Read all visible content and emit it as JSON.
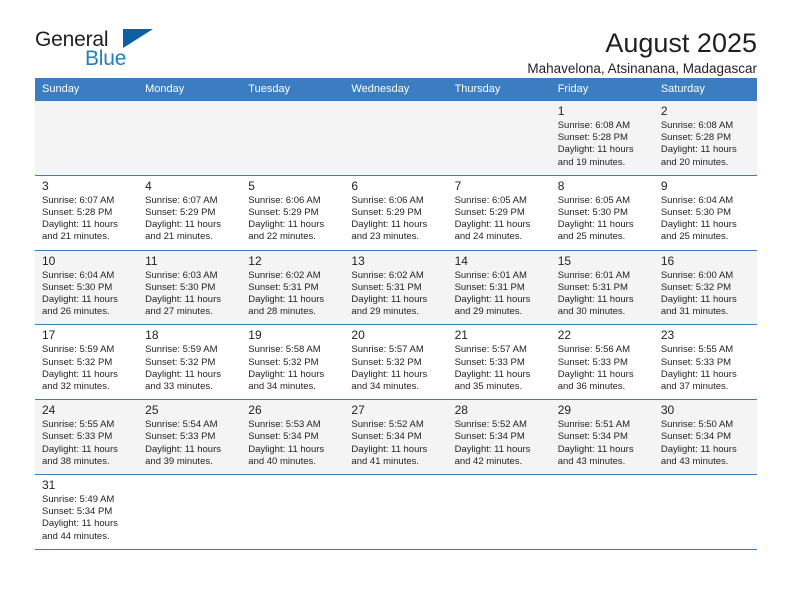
{
  "brand": {
    "name_part1": "General",
    "name_part2": "Blue",
    "accent_color": "#1f7fc4",
    "flag_color": "#0c5fa3"
  },
  "header": {
    "title": "August 2025",
    "subtitle": "Mahavelona, Atsinanana, Madagascar"
  },
  "calendar": {
    "header_bg": "#3b7dc0",
    "weekdays": [
      "Sunday",
      "Monday",
      "Tuesday",
      "Wednesday",
      "Thursday",
      "Friday",
      "Saturday"
    ],
    "weeks": [
      [
        {
          "day": "",
          "info": "",
          "empty": true
        },
        {
          "day": "",
          "info": "",
          "empty": true
        },
        {
          "day": "",
          "info": "",
          "empty": true
        },
        {
          "day": "",
          "info": "",
          "empty": true
        },
        {
          "day": "",
          "info": "",
          "empty": true
        },
        {
          "day": "1",
          "info": "Sunrise: 6:08 AM\nSunset: 5:28 PM\nDaylight: 11 hours\nand 19 minutes."
        },
        {
          "day": "2",
          "info": "Sunrise: 6:08 AM\nSunset: 5:28 PM\nDaylight: 11 hours\nand 20 minutes."
        }
      ],
      [
        {
          "day": "3",
          "info": "Sunrise: 6:07 AM\nSunset: 5:28 PM\nDaylight: 11 hours\nand 21 minutes."
        },
        {
          "day": "4",
          "info": "Sunrise: 6:07 AM\nSunset: 5:29 PM\nDaylight: 11 hours\nand 21 minutes."
        },
        {
          "day": "5",
          "info": "Sunrise: 6:06 AM\nSunset: 5:29 PM\nDaylight: 11 hours\nand 22 minutes."
        },
        {
          "day": "6",
          "info": "Sunrise: 6:06 AM\nSunset: 5:29 PM\nDaylight: 11 hours\nand 23 minutes."
        },
        {
          "day": "7",
          "info": "Sunrise: 6:05 AM\nSunset: 5:29 PM\nDaylight: 11 hours\nand 24 minutes."
        },
        {
          "day": "8",
          "info": "Sunrise: 6:05 AM\nSunset: 5:30 PM\nDaylight: 11 hours\nand 25 minutes."
        },
        {
          "day": "9",
          "info": "Sunrise: 6:04 AM\nSunset: 5:30 PM\nDaylight: 11 hours\nand 25 minutes."
        }
      ],
      [
        {
          "day": "10",
          "info": "Sunrise: 6:04 AM\nSunset: 5:30 PM\nDaylight: 11 hours\nand 26 minutes."
        },
        {
          "day": "11",
          "info": "Sunrise: 6:03 AM\nSunset: 5:30 PM\nDaylight: 11 hours\nand 27 minutes."
        },
        {
          "day": "12",
          "info": "Sunrise: 6:02 AM\nSunset: 5:31 PM\nDaylight: 11 hours\nand 28 minutes."
        },
        {
          "day": "13",
          "info": "Sunrise: 6:02 AM\nSunset: 5:31 PM\nDaylight: 11 hours\nand 29 minutes."
        },
        {
          "day": "14",
          "info": "Sunrise: 6:01 AM\nSunset: 5:31 PM\nDaylight: 11 hours\nand 29 minutes."
        },
        {
          "day": "15",
          "info": "Sunrise: 6:01 AM\nSunset: 5:31 PM\nDaylight: 11 hours\nand 30 minutes."
        },
        {
          "day": "16",
          "info": "Sunrise: 6:00 AM\nSunset: 5:32 PM\nDaylight: 11 hours\nand 31 minutes."
        }
      ],
      [
        {
          "day": "17",
          "info": "Sunrise: 5:59 AM\nSunset: 5:32 PM\nDaylight: 11 hours\nand 32 minutes."
        },
        {
          "day": "18",
          "info": "Sunrise: 5:59 AM\nSunset: 5:32 PM\nDaylight: 11 hours\nand 33 minutes."
        },
        {
          "day": "19",
          "info": "Sunrise: 5:58 AM\nSunset: 5:32 PM\nDaylight: 11 hours\nand 34 minutes."
        },
        {
          "day": "20",
          "info": "Sunrise: 5:57 AM\nSunset: 5:32 PM\nDaylight: 11 hours\nand 34 minutes."
        },
        {
          "day": "21",
          "info": "Sunrise: 5:57 AM\nSunset: 5:33 PM\nDaylight: 11 hours\nand 35 minutes."
        },
        {
          "day": "22",
          "info": "Sunrise: 5:56 AM\nSunset: 5:33 PM\nDaylight: 11 hours\nand 36 minutes."
        },
        {
          "day": "23",
          "info": "Sunrise: 5:55 AM\nSunset: 5:33 PM\nDaylight: 11 hours\nand 37 minutes."
        }
      ],
      [
        {
          "day": "24",
          "info": "Sunrise: 5:55 AM\nSunset: 5:33 PM\nDaylight: 11 hours\nand 38 minutes."
        },
        {
          "day": "25",
          "info": "Sunrise: 5:54 AM\nSunset: 5:33 PM\nDaylight: 11 hours\nand 39 minutes."
        },
        {
          "day": "26",
          "info": "Sunrise: 5:53 AM\nSunset: 5:34 PM\nDaylight: 11 hours\nand 40 minutes."
        },
        {
          "day": "27",
          "info": "Sunrise: 5:52 AM\nSunset: 5:34 PM\nDaylight: 11 hours\nand 41 minutes."
        },
        {
          "day": "28",
          "info": "Sunrise: 5:52 AM\nSunset: 5:34 PM\nDaylight: 11 hours\nand 42 minutes."
        },
        {
          "day": "29",
          "info": "Sunrise: 5:51 AM\nSunset: 5:34 PM\nDaylight: 11 hours\nand 43 minutes."
        },
        {
          "day": "30",
          "info": "Sunrise: 5:50 AM\nSunset: 5:34 PM\nDaylight: 11 hours\nand 43 minutes."
        }
      ],
      [
        {
          "day": "31",
          "info": "Sunrise: 5:49 AM\nSunset: 5:34 PM\nDaylight: 11 hours\nand 44 minutes."
        },
        {
          "day": "",
          "info": "",
          "empty": true
        },
        {
          "day": "",
          "info": "",
          "empty": true
        },
        {
          "day": "",
          "info": "",
          "empty": true
        },
        {
          "day": "",
          "info": "",
          "empty": true
        },
        {
          "day": "",
          "info": "",
          "empty": true
        },
        {
          "day": "",
          "info": "",
          "empty": true
        }
      ]
    ]
  }
}
